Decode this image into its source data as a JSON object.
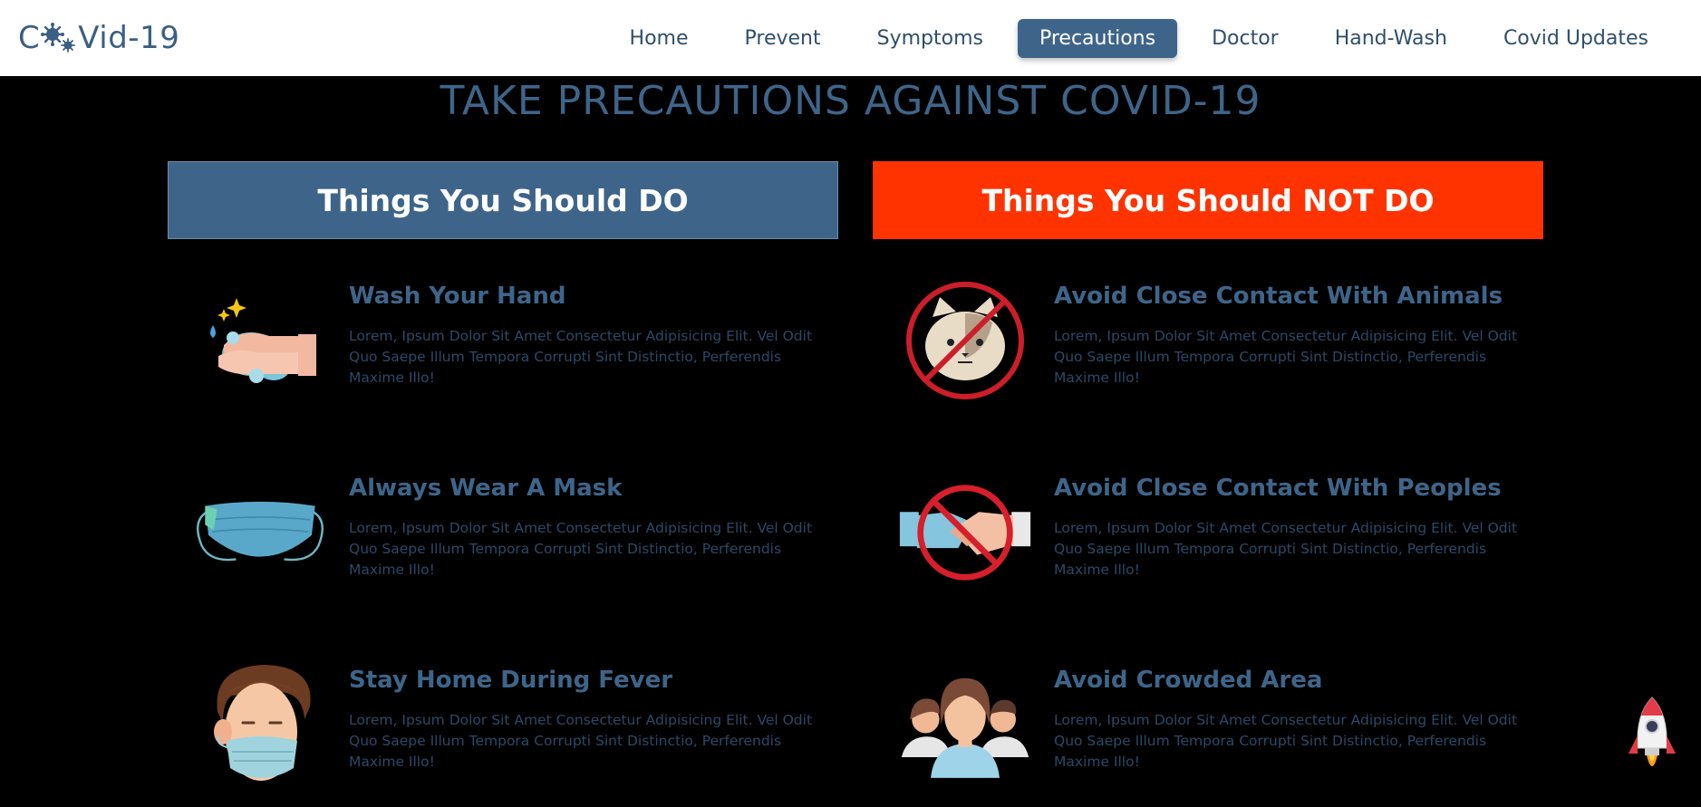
{
  "brand": {
    "logo_prefix": "C",
    "logo_suffix": "Vid-19",
    "colors": {
      "primary": "#3e6589",
      "danger": "#ff3300",
      "background": "#000000"
    }
  },
  "nav": {
    "items": [
      {
        "label": "Home",
        "active": false
      },
      {
        "label": "Prevent",
        "active": false
      },
      {
        "label": "Symptoms",
        "active": false
      },
      {
        "label": "Precautions",
        "active": true
      },
      {
        "label": "Doctor",
        "active": false
      },
      {
        "label": "Hand-Wash",
        "active": false
      },
      {
        "label": "Covid Updates",
        "active": false
      }
    ]
  },
  "page": {
    "title": "TAKE PRECAUTIONS AGAINST COVID-19"
  },
  "do": {
    "header": "Things You Should DO",
    "items": [
      {
        "icon": "hand-wash-icon",
        "title": "Wash Your Hand",
        "text": "Lorem, Ipsum Dolor Sit Amet Consectetur Adipisicing Elit. Vel Odit Quo Saepe Illum Tempora Corrupti Sint Distinctio, Perferendis Maxime Illo!"
      },
      {
        "icon": "face-mask-icon",
        "title": "Always Wear A Mask",
        "text": "Lorem, Ipsum Dolor Sit Amet Consectetur Adipisicing Elit. Vel Odit Quo Saepe Illum Tempora Corrupti Sint Distinctio, Perferendis Maxime Illo!"
      },
      {
        "icon": "masked-person-icon",
        "title": "Stay Home During Fever",
        "text": "Lorem, Ipsum Dolor Sit Amet Consectetur Adipisicing Elit. Vel Odit Quo Saepe Illum Tempora Corrupti Sint Distinctio, Perferendis Maxime Illo!"
      }
    ]
  },
  "dont": {
    "header": "Things You Should NOT DO",
    "items": [
      {
        "icon": "no-animals-icon",
        "title": "Avoid Close Contact With Animals",
        "text": "Lorem, Ipsum Dolor Sit Amet Consectetur Adipisicing Elit. Vel Odit Quo Saepe Illum Tempora Corrupti Sint Distinctio, Perferendis Maxime Illo!"
      },
      {
        "icon": "no-handshake-icon",
        "title": "Avoid Close Contact With Peoples",
        "text": "Lorem, Ipsum Dolor Sit Amet Consectetur Adipisicing Elit. Vel Odit Quo Saepe Illum Tempora Corrupti Sint Distinctio, Perferendis Maxime Illo!"
      },
      {
        "icon": "crowd-icon",
        "title": "Avoid Crowded Area",
        "text": "Lorem, Ipsum Dolor Sit Amet Consectetur Adipisicing Elit. Vel Odit Quo Saepe Illum Tempora Corrupti Sint Distinctio, Perferendis Maxime Illo!"
      }
    ]
  },
  "scroll_top": {
    "icon": "rocket-icon"
  }
}
